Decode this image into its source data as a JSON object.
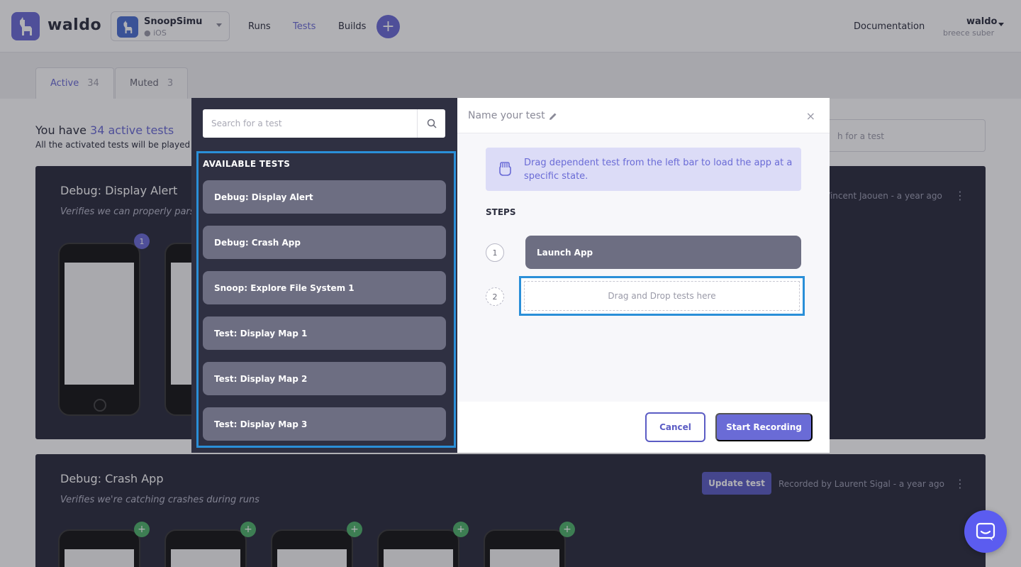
{
  "colors": {
    "accent": "#6a6bd6",
    "highlight_border": "#2a8fd8",
    "card_bg": "#2a2b3d",
    "step_bg": "#6d6e82"
  },
  "brand": {
    "name": "waldo"
  },
  "app_selector": {
    "name": "SnoopSimu",
    "platform": "iOS"
  },
  "nav": {
    "runs": "Runs",
    "tests": "Tests",
    "builds": "Builds",
    "add": "+",
    "documentation": "Documentation"
  },
  "user": {
    "name": "waldo",
    "org": "breece suber"
  },
  "tabs": [
    {
      "label": "Active",
      "count": "34"
    },
    {
      "label": "Muted",
      "count": "3"
    }
  ],
  "intro": {
    "prefix": "You have ",
    "highlight": "34 active tests",
    "subtitle": "All the activated tests will be played"
  },
  "background_search": {
    "placeholder": "h for a test"
  },
  "cards": [
    {
      "title": "Debug: Display Alert",
      "description": "Verifies we can properly parse",
      "meta": "Vincent Jaouen - a year ago",
      "menu": "⋮",
      "badge": "1"
    },
    {
      "title": "Debug: Crash App",
      "description": "Verifies we're catching crashes during runs",
      "meta": "Recorded by Laurent Sigal - a year ago",
      "menu": "⋮",
      "update_label": "Update test",
      "add_badge": "+"
    }
  ],
  "modal": {
    "search": {
      "placeholder": "Search for a test"
    },
    "available_title": "AVAILABLE TESTS",
    "available_tests": [
      "Debug: Display Alert",
      "Debug: Crash App",
      "Snoop: Explore File System 1",
      "Test: Display Map 1",
      "Test: Display Map 2",
      "Test: Display Map 3"
    ],
    "name_placeholder": "Name your test",
    "close": "×",
    "info_text": "Drag dependent test from the left bar to load the app at a specific state.",
    "steps_title": "STEPS",
    "steps": [
      {
        "number": "1",
        "label": "Launch App"
      },
      {
        "number": "2",
        "label": "Drag and Drop tests here"
      }
    ],
    "cancel_label": "Cancel",
    "start_label": "Start Recording"
  },
  "icons": {
    "logo": "llama-icon",
    "apple": "apple-icon",
    "search": "search-icon",
    "pencil": "pencil-icon",
    "hand": "hand-grab-icon",
    "chat": "chat-icon"
  }
}
